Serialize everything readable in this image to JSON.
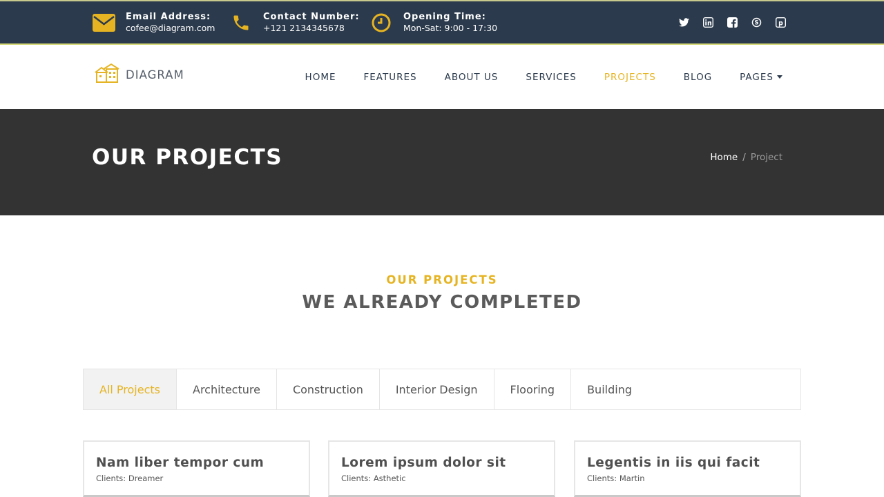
{
  "topbar": {
    "email": {
      "label": "Email Address:",
      "value": "cofee@diagram.com",
      "icon": "envelope-icon"
    },
    "phone": {
      "label": "Contact Number:",
      "value": "+121 2134345678",
      "icon": "phone-icon"
    },
    "hours": {
      "label": "Opening Time:",
      "value": "Mon-Sat: 9:00 - 17:30",
      "icon": "clock-icon"
    },
    "socials": [
      "twitter-icon",
      "linkedin-icon",
      "facebook-icon",
      "skype-icon",
      "pinterest-icon"
    ]
  },
  "nav": {
    "logo_text": "DIAGRAM",
    "items": [
      {
        "label": "HOME"
      },
      {
        "label": "FEATURES"
      },
      {
        "label": "ABOUT US"
      },
      {
        "label": "SERVICES"
      },
      {
        "label": "PROJECTS",
        "active": true
      },
      {
        "label": "BLOG"
      },
      {
        "label": "PAGES",
        "dropdown": true
      }
    ]
  },
  "hero": {
    "title": "OUR PROJECTS",
    "breadcrumb": {
      "home": "Home",
      "separator": "/",
      "current": "Project"
    }
  },
  "section": {
    "subtitle": "OUR PROJECTS",
    "title": "WE ALREADY COMPLETED"
  },
  "filters": [
    {
      "label": "All Projects",
      "active": true
    },
    {
      "label": "Architecture"
    },
    {
      "label": "Construction"
    },
    {
      "label": "Interior Design"
    },
    {
      "label": "Flooring"
    },
    {
      "label": "Building"
    }
  ],
  "projects": [
    {
      "title": "Nam liber tempor cum",
      "client": "Clients: Dreamer"
    },
    {
      "title": "Lorem ipsum dolor sit",
      "client": "Clients: Asthetic"
    },
    {
      "title": "Legentis in iis qui facit",
      "client": "Clients: Martin"
    }
  ],
  "colors": {
    "accent": "#e6b422",
    "topbar_bg": "#2b3a4c",
    "hero_bg": "#333333"
  }
}
